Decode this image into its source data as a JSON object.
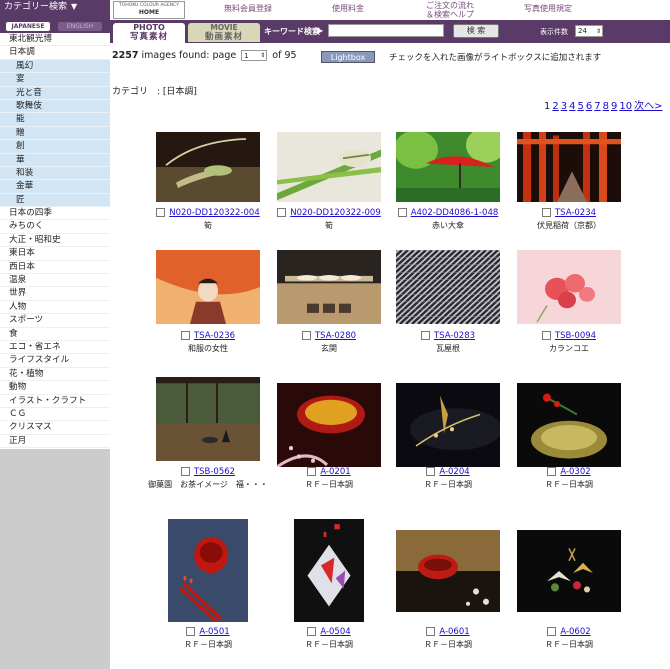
{
  "sidebar": {
    "title": "カテゴリー検索",
    "lang_ja": "JAPANESE",
    "lang_en": "ENGLISH",
    "items": [
      {
        "label": "東北観光博",
        "type": "top"
      },
      {
        "label": "日本調",
        "type": "top"
      },
      {
        "label": "風幻",
        "type": "sub"
      },
      {
        "label": "宴",
        "type": "sub"
      },
      {
        "label": "光と音",
        "type": "sub"
      },
      {
        "label": "歌舞伎",
        "type": "sub"
      },
      {
        "label": "能",
        "type": "sub"
      },
      {
        "label": "贈",
        "type": "sub"
      },
      {
        "label": "創",
        "type": "sub"
      },
      {
        "label": "華",
        "type": "sub"
      },
      {
        "label": "和装",
        "type": "sub"
      },
      {
        "label": "金華",
        "type": "sub"
      },
      {
        "label": "匠",
        "type": "sub"
      },
      {
        "label": "日本の四季",
        "type": "top"
      },
      {
        "label": "みちのく",
        "type": "top"
      },
      {
        "label": "大正・昭和史",
        "type": "top"
      },
      {
        "label": "東日本",
        "type": "top"
      },
      {
        "label": "西日本",
        "type": "top"
      },
      {
        "label": "温泉",
        "type": "top"
      },
      {
        "label": "世界",
        "type": "top"
      },
      {
        "label": "人物",
        "type": "top"
      },
      {
        "label": "スポーツ",
        "type": "top"
      },
      {
        "label": "食",
        "type": "top"
      },
      {
        "label": "エコ・省エネ",
        "type": "top"
      },
      {
        "label": "ライフスタイル",
        "type": "top"
      },
      {
        "label": "花・植物",
        "type": "top"
      },
      {
        "label": "動物",
        "type": "top"
      },
      {
        "label": "イラスト・クラフト",
        "type": "top"
      },
      {
        "label": "ＣＧ",
        "type": "top"
      },
      {
        "label": "クリスマス",
        "type": "top"
      },
      {
        "label": "正月",
        "type": "top"
      }
    ]
  },
  "topnav": {
    "logo_line1": "TOHOKU COLOUR AGENCY",
    "logo_line2": "HOME",
    "links": [
      "無料会員登録",
      "使用料金",
      "ご注文の流れ",
      "＆検索ヘルプ",
      "写真使用規定"
    ]
  },
  "tabs": {
    "photo_en": "PHOTO",
    "photo_ja": "写真素材",
    "movie_en": "MOVIE",
    "movie_ja": "動画素材",
    "keyword_label": "キーワード検索",
    "search_button": "検 索",
    "per_page_label": "表示件数",
    "per_page_value": "24"
  },
  "results": {
    "count": "2257",
    "found_text": "images found: page",
    "page_value": "1",
    "of_text": "of 95",
    "lightbox_label": "Lightbox",
    "lightbox_note": "チェックを入れた画像がライトボックスに追加されます",
    "category_text": "カテゴリ　: [日本調]"
  },
  "pager": {
    "current": "1",
    "pages": [
      "2",
      "3",
      "4",
      "5",
      "6",
      "7",
      "8",
      "9",
      "10"
    ],
    "next": "次へ>"
  },
  "images": [
    {
      "code": "N020-DD120322-004",
      "desc": "筍",
      "icon": "bamboo-shoot-photo"
    },
    {
      "code": "N020-DD120322-009",
      "desc": "筍",
      "icon": "bamboo-leaf-photo"
    },
    {
      "code": "A402-DD4086-1-048",
      "desc": "赤い大傘",
      "icon": "red-umbrella-photo"
    },
    {
      "code": "TSA-0234",
      "desc": "伏見稲荷（京都）",
      "icon": "torii-gates-photo"
    },
    {
      "code": "TSA-0236",
      "desc": "和服の女性",
      "icon": "kimono-woman-photo"
    },
    {
      "code": "TSA-0280",
      "desc": "玄関",
      "icon": "entrance-photo"
    },
    {
      "code": "TSA-0283",
      "desc": "瓦屋根",
      "icon": "tile-roof-photo"
    },
    {
      "code": "TSB-0094",
      "desc": "カランコエ",
      "icon": "kalanchoe-photo"
    },
    {
      "code": "TSB-0562",
      "desc": "御菓園　お茶イメージ　福・・・",
      "icon": "tea-room-photo"
    },
    {
      "code": "A-0201",
      "desc": "ＲＦ－日本調",
      "icon": "lacquer-cup-photo"
    },
    {
      "code": "A-0204",
      "desc": "ＲＦ－日本調",
      "icon": "gold-glass-photo"
    },
    {
      "code": "A-0302",
      "desc": "ＲＦ－日本調",
      "icon": "gold-plate-photo"
    },
    {
      "code": "A-0501",
      "desc": "ＲＦ－日本調",
      "icon": "red-bowl-chopsticks-photo"
    },
    {
      "code": "A-0504",
      "desc": "ＲＦ－日本調",
      "icon": "origami-photo"
    },
    {
      "code": "A-0601",
      "desc": "ＲＦ－日本調",
      "icon": "sake-cup-photo"
    },
    {
      "code": "A-0602",
      "desc": "ＲＦ－日本調",
      "icon": "paper-cranes-photo"
    }
  ],
  "colors": {
    "brand_purple": "#5a3a66",
    "subcategory_blue": "#d2e5f4",
    "link_blue": "#1a0dcc"
  }
}
